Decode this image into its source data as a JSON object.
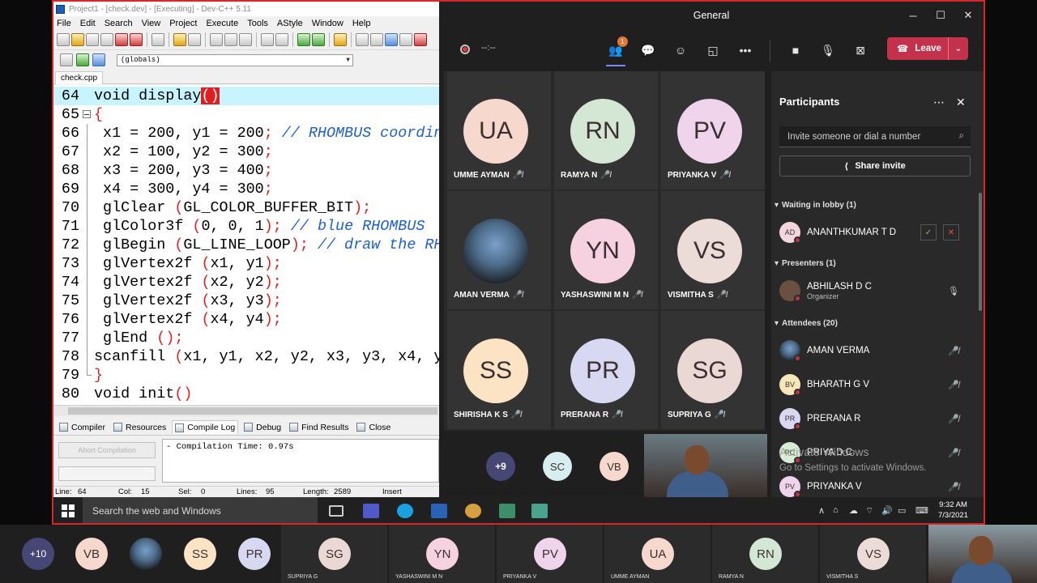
{
  "devcpp": {
    "title": "Project1 - [check.dev] - [Executing] - Dev-C++ 5.11",
    "menu": [
      "File",
      "Edit",
      "Search",
      "View",
      "Project",
      "Execute",
      "Tools",
      "AStyle",
      "Window",
      "Help"
    ],
    "scope_dropdown": "(globals)",
    "file_tab": "check.cpp",
    "code_lines": [
      {
        "n": "64",
        "t": "void display()"
      },
      {
        "n": "65",
        "t": "{"
      },
      {
        "n": "66",
        "t": " x1 = 200, y1 = 200; // RHOMBUS coordin"
      },
      {
        "n": "67",
        "t": " x2 = 100, y2 = 300;"
      },
      {
        "n": "68",
        "t": " x3 = 200, y3 = 400;"
      },
      {
        "n": "69",
        "t": " x4 = 300, y4 = 300;"
      },
      {
        "n": "70",
        "t": " glClear (GL_COLOR_BUFFER_BIT);"
      },
      {
        "n": "71",
        "t": " glColor3f (0, 0, 1); // blue RHOMBUS"
      },
      {
        "n": "72",
        "t": " glBegin (GL_LINE_LOOP); // draw the RH"
      },
      {
        "n": "73",
        "t": " glVertex2f (x1, y1);"
      },
      {
        "n": "74",
        "t": " glVertex2f (x2, y2);"
      },
      {
        "n": "75",
        "t": " glVertex2f (x3, y3);"
      },
      {
        "n": "76",
        "t": " glVertex2f (x4, y4);"
      },
      {
        "n": "77",
        "t": " glEnd ();"
      },
      {
        "n": "78",
        "t": "scanfill (x1, y1, x2, y2, x3, y3, x4, y"
      },
      {
        "n": "79",
        "t": "}"
      },
      {
        "n": "80",
        "t": "void init()"
      }
    ],
    "bottom_tabs": [
      "Compiler",
      "Resources",
      "Compile Log",
      "Debug",
      "Find Results",
      "Close"
    ],
    "abort_label": "Abort Compilation",
    "log_text": "- Compilation Time: 0.97s",
    "status": {
      "line_label": "Line:",
      "line": "64",
      "col_label": "Col:",
      "col": "15",
      "sel_label": "Sel:",
      "sel": "0",
      "lines_label": "Lines:",
      "lines": "95",
      "length_label": "Length:",
      "length": "2589",
      "mode": "Insert"
    }
  },
  "teams": {
    "title": "General",
    "timer": "--:--",
    "participants_badge": "1",
    "leave_label": "Leave",
    "gallery": [
      {
        "initials": "UA",
        "name": "UMME AYMAN",
        "color": "#f7d8cc"
      },
      {
        "initials": "RN",
        "name": "RAMYA N",
        "color": "#d4e6d4"
      },
      {
        "initials": "PV",
        "name": "PRIYANKA V",
        "color": "#efd4ec"
      },
      {
        "initials": "",
        "name": "AMAN VERMA",
        "color": "#4e6d8c"
      },
      {
        "initials": "YN",
        "name": "YASHASWINI M N",
        "color": "#f6d2e0"
      },
      {
        "initials": "VS",
        "name": "VISMITHA S",
        "color": "#ecdcd8"
      },
      {
        "initials": "SS",
        "name": "SHIRISHA K S",
        "color": "#fbe3c4"
      },
      {
        "initials": "PR",
        "name": "PRERANA R",
        "color": "#d8d8f2"
      },
      {
        "initials": "SG",
        "name": "SUPRIYA G",
        "color": "#ead8d4"
      }
    ],
    "overflow_count": "+9",
    "overflow_avatars": [
      {
        "initials": "SC",
        "color": "#d6eef0"
      },
      {
        "initials": "VB",
        "color": "#f7d8cc"
      }
    ],
    "panel": {
      "title": "Participants",
      "invite_placeholder": "Invite someone or dial a number",
      "share_label": "Share invite",
      "lobby_header": "Waiting in lobby (1)",
      "lobby": [
        {
          "initials": "AD",
          "name": "ANANTHKUMAR T D",
          "color": "#f2d8de"
        }
      ],
      "presenters_header": "Presenters (1)",
      "presenters": [
        {
          "name": "ABHILASH D C",
          "role": "Organizer"
        }
      ],
      "attendees_header": "Attendees (20)",
      "attendees": [
        {
          "initials": "",
          "name": "AMAN VERMA",
          "color": "#4e6d8c"
        },
        {
          "initials": "BV",
          "name": "BHARATH G V",
          "color": "#f7e6b8"
        },
        {
          "initials": "PR",
          "name": "PRERANA R",
          "color": "#d8d8f2"
        },
        {
          "initials": "PC",
          "name": "PRIYA D C",
          "color": "#d8eed4"
        },
        {
          "initials": "PV",
          "name": "PRIYANKA V",
          "color": "#efd4ec"
        }
      ],
      "watermark_line1": "Activate Windows",
      "watermark_line2": "Go to Settings to activate Windows."
    }
  },
  "taskbar": {
    "search_placeholder": "Search the web and Windows",
    "time": "9:32 AM",
    "date": "7/3/2021"
  },
  "bottom_strip": {
    "overflow_count": "+10",
    "avatars": [
      {
        "initials": "VB",
        "color": "#f7d8cc"
      },
      {
        "initials": "",
        "color": "#4e6d8c"
      },
      {
        "initials": "SS",
        "color": "#fbe3c4"
      },
      {
        "initials": "PR",
        "color": "#d8d8f2"
      }
    ],
    "tiles": [
      {
        "initials": "SG",
        "name": "SUPRIYA G",
        "color": "#ead8d4"
      },
      {
        "initials": "YN",
        "name": "YASHASWINI M N",
        "color": "#f6d2e0"
      },
      {
        "initials": "PV",
        "name": "PRIYANKA V",
        "color": "#efd4ec"
      },
      {
        "initials": "UA",
        "name": "UMME AYMAN",
        "color": "#f7d8cc"
      },
      {
        "initials": "RN",
        "name": "RAMYA N",
        "color": "#d4e6d4"
      },
      {
        "initials": "VS",
        "name": "VISMITHA S",
        "color": "#ecdcd8"
      }
    ]
  }
}
